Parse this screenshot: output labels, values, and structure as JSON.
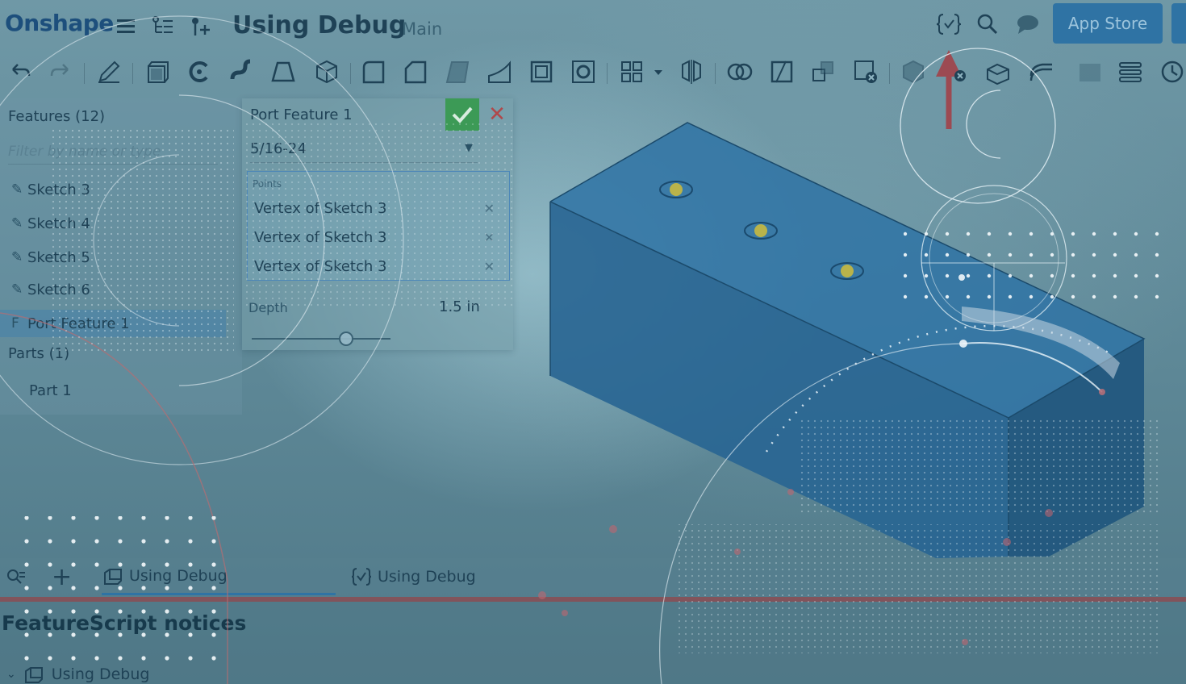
{
  "app": {
    "logo": "Onshape",
    "document_title": "Using Debug",
    "branch": "Main",
    "app_store_label": "App Store"
  },
  "header_icons": [
    "menu-icon",
    "feature-list-icon",
    "insert-icon",
    "featurescript-icon",
    "search-icon",
    "chat-icon"
  ],
  "feature_panel": {
    "title": "Features (12)",
    "filter_placeholder": "Filter by name or type",
    "features": [
      {
        "label": "Sketch 3",
        "icon": "sketch-icon"
      },
      {
        "label": "Sketch 4",
        "icon": "sketch-icon"
      },
      {
        "label": "Sketch 5",
        "icon": "sketch-icon"
      },
      {
        "label": "Sketch 6",
        "icon": "sketch-icon"
      },
      {
        "label": "Port Feature 1",
        "icon": "custom-feature-icon",
        "selected": true
      }
    ],
    "parts_title": "Parts (1)",
    "parts": [
      {
        "label": "Part 1"
      }
    ]
  },
  "dialog": {
    "title": "Port Feature 1",
    "size_value": "5/16-24",
    "points_label": "Points",
    "points": [
      "Vertex of Sketch 3",
      "Vertex of Sketch 3",
      "Vertex of Sketch 3"
    ],
    "depth_label": "Depth",
    "depth_value": "1.5 in"
  },
  "tabs": [
    {
      "label": "Using Debug",
      "icon": "part-studio-icon",
      "active": true
    },
    {
      "label": "Using Debug",
      "icon": "featurescript-icon",
      "active": false
    }
  ],
  "notices": {
    "title": "FeatureScript notices",
    "items": [
      {
        "label": "Using Debug",
        "icon": "part-studio-icon"
      }
    ]
  },
  "colors": {
    "brand": "#1d4f7c",
    "accent": "#2f73a4",
    "ok": "#3c9a56",
    "cancel": "#b0484a",
    "model_top": "#2f73a4",
    "model_front": "#2a628a",
    "model_side": "#225479"
  }
}
